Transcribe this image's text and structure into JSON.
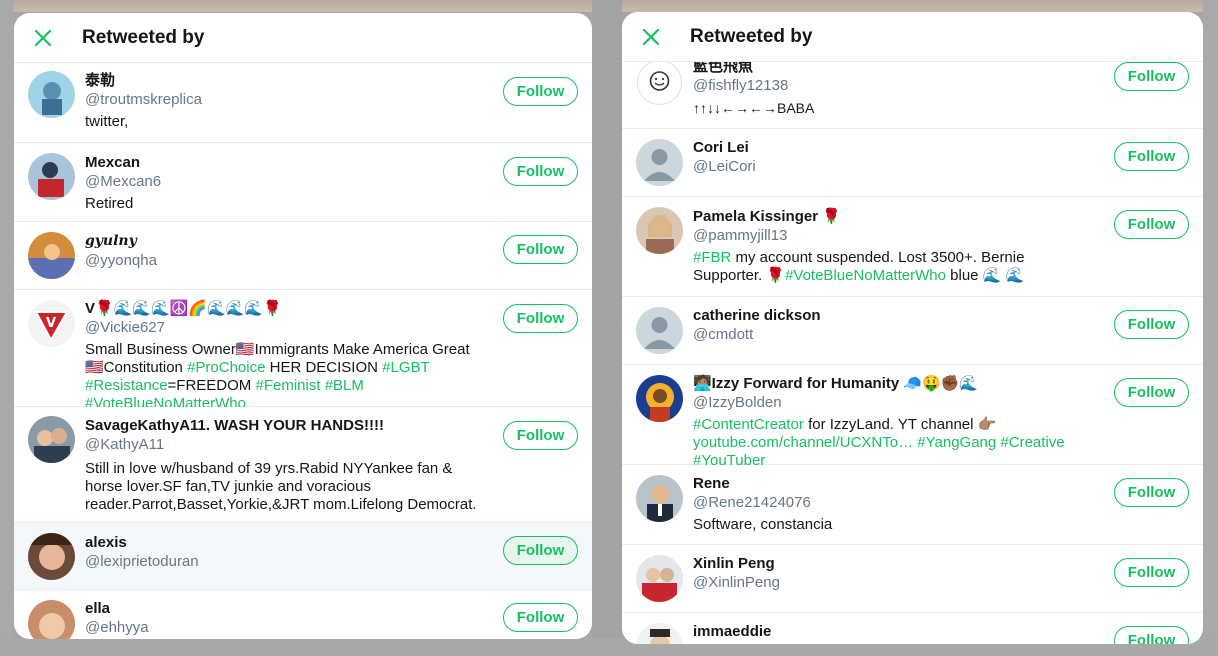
{
  "left_modal": {
    "title": "Retweeted by",
    "follow_label": "Follow",
    "users": [
      {
        "name": "泰勒",
        "handle": "@troutmskreplica",
        "bio": "twitter,"
      },
      {
        "name": "Mexcan",
        "handle": "@Mexcan6",
        "bio": "Retired"
      },
      {
        "name": "𝒈𝒚𝒖𝒍𝒏𝒚",
        "handle": "@yyonqha",
        "bio": ""
      },
      {
        "name": "V🌹🌊🌊🌊☮️🌈🌊🌊🌊🌹",
        "handle": "@Vickie627",
        "bio_parts": [
          {
            "t": "Small Business Owner🇺🇸Immigrants Make America Great🇺🇸Constitution "
          },
          {
            "t": "#ProChoice",
            "tag": true
          },
          {
            "t": " HER DECISION "
          },
          {
            "t": "#LGBT",
            "tag": true
          },
          {
            "t": " "
          },
          {
            "t": "#Resistance",
            "tag": true
          },
          {
            "t": "=FREEDOM "
          },
          {
            "t": "#Feminist",
            "tag": true
          },
          {
            "t": " "
          },
          {
            "t": "#BLM",
            "tag": true
          },
          {
            "t": " "
          },
          {
            "t": "#VoteBlueNoMatterWho",
            "tag": true
          }
        ]
      },
      {
        "name": "SavageKathyA11. WASH YOUR HANDS!!!!",
        "handle": "@KathyA11",
        "bio": "Still in love w/husband of 39 yrs.Rabid NYYankee fan & horse lover.SF fan,TV junkie and voracious reader.Parrot,Basset,Yorkie,&JRT mom.Lifelong Democrat."
      },
      {
        "name": "alexis",
        "handle": "@lexiprietoduran",
        "bio": ""
      },
      {
        "name": "ella",
        "handle": "@ehhyya",
        "bio": ""
      }
    ]
  },
  "right_modal": {
    "title": "Retweeted by",
    "follow_label": "Follow",
    "users": [
      {
        "name": "藍色飛魚",
        "handle": "@fishfly12138",
        "bio": "↑↑↓↓←→←→BABA"
      },
      {
        "name": "Cori Lei",
        "handle": "@LeiCori",
        "bio": ""
      },
      {
        "name": "Pamela Kissinger 🌹",
        "handle": "@pammyjill13",
        "bio_parts": [
          {
            "t": "#FBR",
            "tag": true
          },
          {
            "t": " my account suspended. Lost 3500+. Bernie Supporter. 🌹"
          },
          {
            "t": "#VoteBlueNoMatterWho",
            "tag": true
          },
          {
            "t": " blue 🌊 🌊"
          }
        ]
      },
      {
        "name": "catherine dickson",
        "handle": "@cmdott",
        "bio": ""
      },
      {
        "name": "🧑🏽‍💻Izzy Forward for Humanity 🧢🤑✊🏾🌊",
        "handle": "@IzzyBolden",
        "bio_parts": [
          {
            "t": "#ContentCreator",
            "tag": true
          },
          {
            "t": " for IzzyLand. YT channel 👉🏽 "
          },
          {
            "t": "youtube.com/channel/UCXNTo…",
            "tag": true
          },
          {
            "t": " "
          },
          {
            "t": "#YangGang",
            "tag": true
          },
          {
            "t": " "
          },
          {
            "t": "#Creative",
            "tag": true
          },
          {
            "t": " "
          },
          {
            "t": "#YouTuber",
            "tag": true
          }
        ]
      },
      {
        "name": "Rene",
        "handle": "@Rene21424076",
        "bio": "Software, constancia"
      },
      {
        "name": "Xinlin Peng",
        "handle": "@XinlinPeng",
        "bio": ""
      },
      {
        "name": "immaeddie",
        "handle": "",
        "bio": ""
      }
    ]
  },
  "colors": {
    "accent": "#17bf63",
    "text": "#14171a",
    "muted": "#657786",
    "divider": "#e6ecf0"
  }
}
